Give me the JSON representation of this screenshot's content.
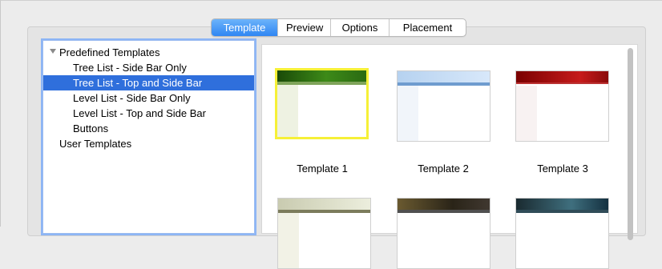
{
  "tabs": [
    {
      "label": "Template",
      "active": true
    },
    {
      "label": "Preview",
      "active": false
    },
    {
      "label": "Options",
      "active": false
    },
    {
      "label": "Placement",
      "active": false
    }
  ],
  "tree": {
    "items": [
      {
        "label": "Predefined Templates",
        "expanded": true,
        "selected": false
      },
      {
        "label": "Tree List - Side Bar Only",
        "selected": false
      },
      {
        "label": "Tree List - Top and Side Bar",
        "selected": true
      },
      {
        "label": "Level List - Side Bar Only",
        "selected": false
      },
      {
        "label": "Level List - Top and Side Bar",
        "selected": false
      },
      {
        "label": "Buttons",
        "selected": false
      },
      {
        "label": "User Templates",
        "selected": false
      }
    ]
  },
  "templates": [
    {
      "caption": "Template 1",
      "selected": true,
      "theme": "green"
    },
    {
      "caption": "Template 2",
      "selected": false,
      "theme": "blue"
    },
    {
      "caption": "Template 3",
      "selected": false,
      "theme": "red"
    },
    {
      "caption": "",
      "selected": false,
      "theme": "olive"
    },
    {
      "caption": "",
      "selected": false,
      "theme": "dark"
    },
    {
      "caption": "",
      "selected": false,
      "theme": "teal"
    }
  ],
  "colors": {
    "accent": "#2f86f3",
    "selection": "#2f6fdc",
    "thumb_selected_border": "#f6f037"
  }
}
